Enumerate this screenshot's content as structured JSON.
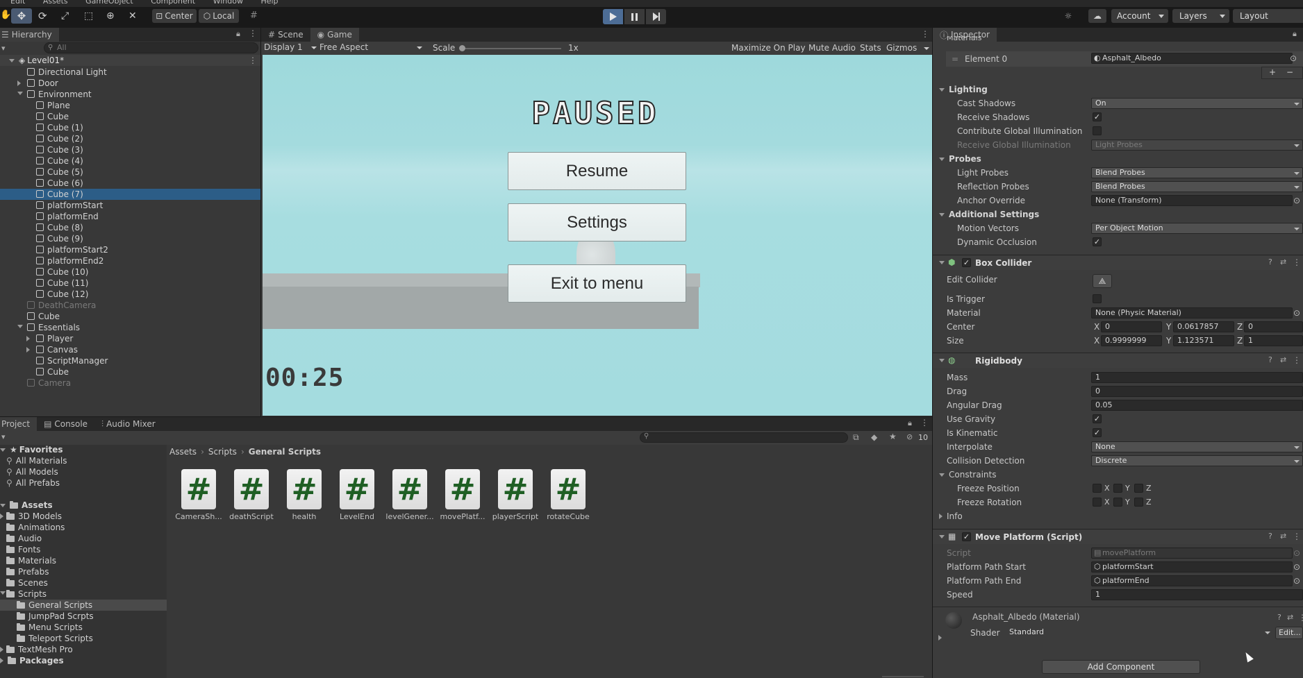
{
  "menubar": {
    "items": [
      "Edit",
      "Assets",
      "GameObject",
      "Component",
      "Window",
      "Help"
    ]
  },
  "toolbar": {
    "center_label": "Center",
    "local_label": "Local",
    "account_label": "Account",
    "layers_label": "Layers",
    "layout_label": "Layout"
  },
  "hierarchy": {
    "tab": "Hierarchy",
    "search_placeholder": "All",
    "scene": "Level01*",
    "items": [
      {
        "label": "Directional Light"
      },
      {
        "label": "Door"
      },
      {
        "label": "Environment"
      },
      {
        "label": "Plane"
      },
      {
        "label": "Cube"
      },
      {
        "label": "Cube (1)"
      },
      {
        "label": "Cube (2)"
      },
      {
        "label": "Cube (3)"
      },
      {
        "label": "Cube (4)"
      },
      {
        "label": "Cube (5)"
      },
      {
        "label": "Cube (6)"
      },
      {
        "label": "Cube (7)"
      },
      {
        "label": "platformStart"
      },
      {
        "label": "platformEnd"
      },
      {
        "label": "Cube (8)"
      },
      {
        "label": "Cube (9)"
      },
      {
        "label": "platformStart2"
      },
      {
        "label": "platformEnd2"
      },
      {
        "label": "Cube (10)"
      },
      {
        "label": "Cube (11)"
      },
      {
        "label": "Cube (12)"
      },
      {
        "label": "DeathCamera"
      },
      {
        "label": "Cube"
      },
      {
        "label": "Essentials"
      },
      {
        "label": "Player"
      },
      {
        "label": "Canvas"
      },
      {
        "label": "ScriptManager"
      },
      {
        "label": "Cube"
      },
      {
        "label": "Camera"
      }
    ]
  },
  "game": {
    "tabs": [
      "Scene",
      "Game"
    ],
    "display": "Display 1",
    "aspect": "Free Aspect",
    "scale_label": "Scale",
    "scale_value": "1x",
    "toggles": [
      "Maximize On Play",
      "Mute Audio",
      "Stats",
      "Gizmos"
    ],
    "paused_title": "PAUSED",
    "buttons": [
      "Resume",
      "Settings",
      "Exit to menu"
    ],
    "timer": "00:25"
  },
  "project": {
    "tabs": [
      "Project",
      "Console",
      "Audio Mixer"
    ],
    "hidden_count": "10",
    "favorites_title": "Favorites",
    "favorites": [
      "All Materials",
      "All Models",
      "All Prefabs"
    ],
    "assets_title": "Assets",
    "folders": [
      "3D Models",
      "Animations",
      "Audio",
      "Fonts",
      "Materials",
      "Prefabs",
      "Scenes",
      "Scripts",
      "General Scripts",
      "JumpPad Scrpts",
      "Menu Scripts",
      "Teleport Scripts",
      "TextMesh Pro"
    ],
    "packages_title": "Packages",
    "breadcrumb": [
      "Assets",
      "Scripts",
      "General Scripts"
    ],
    "files": [
      "CameraSh...",
      "deathScript",
      "health",
      "LevelEnd",
      "levelGener...",
      "movePlatf...",
      "playerScript",
      "rotateCube"
    ],
    "script_glyph": "#"
  },
  "inspector": {
    "tab": "Inspector",
    "materials_label": "Materials",
    "element0_label": "Element 0",
    "element0_value": "Asphalt_Albedo",
    "lighting": "Lighting",
    "cast_shadows": "Cast Shadows",
    "cast_shadows_value": "On",
    "receive_shadows": "Receive Shadows",
    "contribute_gi": "Contribute Global Illumination",
    "receive_gi": "Receive Global Illumination",
    "receive_gi_value": "Light Probes",
    "probes": "Probes",
    "light_probes": "Light Probes",
    "light_probes_value": "Blend Probes",
    "reflection_probes": "Reflection Probes",
    "reflection_probes_value": "Blend Probes",
    "anchor_override": "Anchor Override",
    "anchor_override_value": "None (Transform)",
    "additional": "Additional Settings",
    "motion_vectors": "Motion Vectors",
    "motion_vectors_value": "Per Object Motion",
    "dynamic_occlusion": "Dynamic Occlusion",
    "box_collider": "Box Collider",
    "edit_collider": "Edit Collider",
    "is_trigger": "Is Trigger",
    "material": "Material",
    "material_value": "None (Physic Material)",
    "center": "Center",
    "center_x": "0",
    "center_y": "0.0617857",
    "center_z": "0",
    "size": "Size",
    "size_x": "0.9999999",
    "size_y": "1.123571",
    "size_z": "1",
    "rigidbody": "Rigidbody",
    "mass": "Mass",
    "mass_value": "1",
    "drag": "Drag",
    "drag_value": "0",
    "angular_drag": "Angular Drag",
    "angular_drag_value": "0.05",
    "use_gravity": "Use Gravity",
    "is_kinematic": "Is Kinematic",
    "interpolate": "Interpolate",
    "interpolate_value": "None",
    "collision_detection": "Collision Detection",
    "collision_detection_value": "Discrete",
    "constraints": "Constraints",
    "freeze_position": "Freeze Position",
    "freeze_rotation": "Freeze Rotation",
    "axis_x": "X",
    "axis_y": "Y",
    "axis_z": "Z",
    "info": "Info",
    "move_platform": "Move Platform (Script)",
    "script": "Script",
    "script_value": "movePlatform",
    "path_start": "Platform Path Start",
    "path_start_value": "platformStart",
    "path_end": "Platform Path End",
    "path_end_value": "platformEnd",
    "speed": "Speed",
    "speed_value": "1",
    "material_name": "Asphalt_Albedo (Material)",
    "shader": "Shader",
    "shader_value": "Standard",
    "edit_button": "Edit...",
    "add_component": "Add Component"
  }
}
